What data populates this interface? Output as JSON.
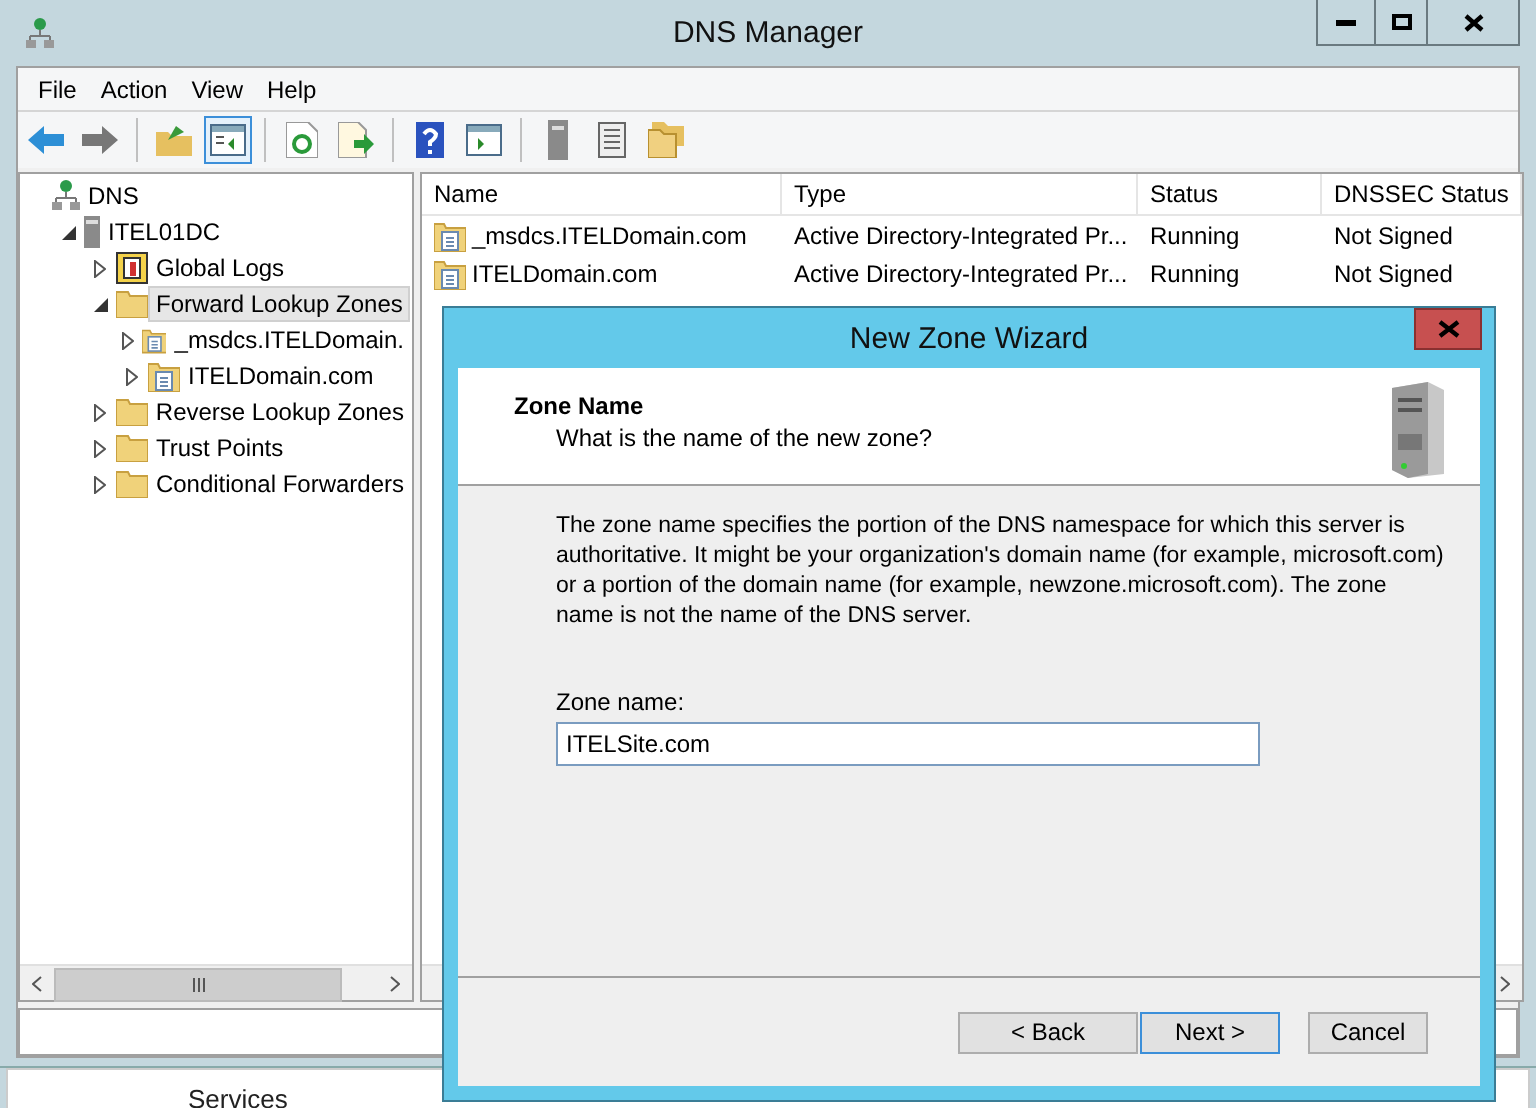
{
  "window": {
    "title": "DNS Manager"
  },
  "menu": [
    "File",
    "Action",
    "View",
    "Help"
  ],
  "toolbar": [
    {
      "kind": "back",
      "selected": false
    },
    {
      "kind": "forward",
      "selected": false
    },
    {
      "kind": "sep"
    },
    {
      "kind": "up",
      "selected": false
    },
    {
      "kind": "tree",
      "selected": true
    },
    {
      "kind": "sep"
    },
    {
      "kind": "refresh",
      "selected": false
    },
    {
      "kind": "export",
      "selected": false
    },
    {
      "kind": "sep"
    },
    {
      "kind": "help",
      "selected": false
    },
    {
      "kind": "pane",
      "selected": false
    },
    {
      "kind": "sep"
    },
    {
      "kind": "server",
      "selected": false
    },
    {
      "kind": "list",
      "selected": false
    },
    {
      "kind": "folders",
      "selected": false
    }
  ],
  "tree": [
    {
      "label": "DNS",
      "kind": "dns",
      "selected": false,
      "children": [
        {
          "label": "ITEL01DC",
          "kind": "server",
          "expanded": true,
          "selected": false,
          "children": [
            {
              "label": "Global Logs",
              "kind": "log",
              "expanded": false,
              "selected": false
            },
            {
              "label": "Forward Lookup Zones",
              "kind": "folder",
              "expanded": true,
              "selected": true,
              "children": [
                {
                  "label": "_msdcs.ITELDomain.",
                  "kind": "zone",
                  "expanded": false,
                  "selected": false
                },
                {
                  "label": "ITELDomain.com",
                  "kind": "zone",
                  "expanded": false,
                  "selected": false
                }
              ]
            },
            {
              "label": "Reverse Lookup Zones",
              "kind": "folder",
              "expanded": false,
              "selected": false
            },
            {
              "label": "Trust Points",
              "kind": "folder",
              "expanded": false,
              "selected": false
            },
            {
              "label": "Conditional Forwarders",
              "kind": "folder",
              "expanded": false,
              "selected": false
            }
          ]
        }
      ]
    }
  ],
  "table": {
    "columns": [
      "Name",
      "Type",
      "Status",
      "DNSSEC Status"
    ],
    "rows": [
      [
        "_msdcs.ITELDomain.com",
        "Active Directory-Integrated Pr...",
        "Running",
        "Not Signed"
      ],
      [
        "ITELDomain.com",
        "Active Directory-Integrated Pr...",
        "Running",
        "Not Signed"
      ]
    ]
  },
  "dialog": {
    "title": "New Zone Wizard",
    "heading": "Zone Name",
    "subheading": "What is the name of the new zone?",
    "description": "The zone name specifies the portion of the DNS namespace for which this server is authoritative. It might be your organization's domain name (for example,  microsoft.com) or a portion of the domain name (for example, newzone.microsoft.com). The zone name is not the name of the DNS server.",
    "field_label": "Zone name:",
    "field_value": "ITELSite.com",
    "buttons": [
      {
        "label": "< Back",
        "default": false
      },
      {
        "label": "Next >",
        "default": true
      },
      {
        "label": "Cancel",
        "default": false
      }
    ]
  },
  "background_window": {
    "label": "Services"
  }
}
